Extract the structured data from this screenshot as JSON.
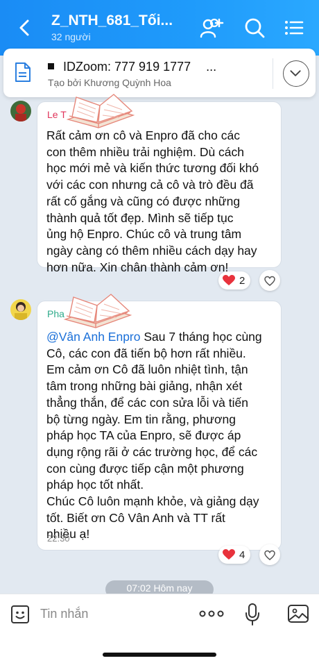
{
  "header": {
    "title": "Z_NTH_681_Tối...",
    "member_count": "32 người",
    "bg_color": "#1f9bfb"
  },
  "pinned": {
    "text": "IDZoom: 777 919 1777",
    "more": "...",
    "creator": "Tạo bởi Khương Quỳnh Hoa"
  },
  "messages": [
    {
      "sender": "Le T",
      "sender_color": "#e0345a",
      "lines": [
        "Rất cảm ơn cô và Enpro đã cho các",
        "con thêm nhiều trải nghiệm. Dù cách",
        "học mới mẻ và kiến thức tương đối khó",
        "với các con nhưng cả cô và trò đều đã",
        "rất cố gắng và cũng có được những",
        "thành quả tốt đẹp. Mình sẽ tiếp tục",
        "ủng hộ Enpro. Chúc cô và trung tâm",
        "ngày càng có thêm nhiều cách dạy hay",
        "hơn nữa. Xin chân thành cảm ơn!"
      ],
      "reaction_count": "2"
    },
    {
      "sender": "Pha",
      "sender_color": "#2eaa8a",
      "mention": "@Vân Anh Enpro",
      "first_line_rest": " Sau 7 tháng học cùng",
      "lines": [
        "Cô, các con đã tiến bộ hơn rất nhiều.",
        "Em cảm ơn Cô đã luôn nhiệt tình, tận",
        "tâm trong những bài giảng, nhận xét",
        "thẳng thắn, để các con sửa lỗi và tiến",
        "bộ từng ngày. Em tin rằng, phương",
        "pháp học TA của Enpro, sẽ được áp",
        "dụng rộng rãi ở các trường học, để các",
        "con cùng được tiếp cận một phương",
        "pháp học tốt nhất.",
        "Chúc Cô luôn mạnh khỏe, và giảng dạy",
        "tốt. Biết ơn Cô Vân Anh  và TT rất",
        "nhiều ạ!"
      ],
      "time": "22:30",
      "reaction_count": "4"
    }
  ],
  "date_separator": "07:02 Hôm nay",
  "composer": {
    "placeholder": "Tin nhắn"
  },
  "icons": [
    "back-arrow-icon",
    "add-member-icon",
    "search-icon",
    "menu-list-icon",
    "document-icon",
    "chevron-down-icon",
    "heart-icon",
    "like-heart-icon",
    "book-sticker-icon",
    "emoji-icon",
    "more-icon",
    "microphone-icon",
    "image-icon"
  ]
}
